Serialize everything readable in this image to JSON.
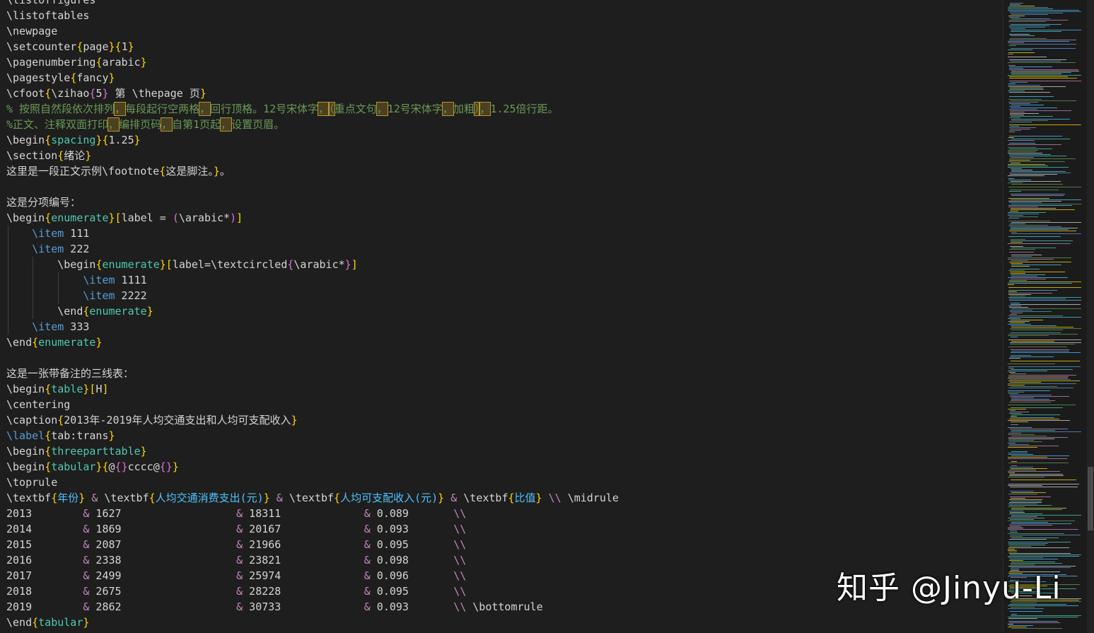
{
  "editor": {
    "colors": {
      "background": "#1e1e1e",
      "text": "#d4d4d4",
      "keyword": "#569cd6",
      "environment": "#4ec9b0",
      "bracket": "#ffd700",
      "comment": "#6a9955",
      "ampersand": "#c586c0",
      "bold_text": "#4fc1ff"
    },
    "lines": [
      "\\listoffigures",
      "\\listoftables",
      "\\newpage",
      "\\setcounter{page}{1}",
      "\\pagenumbering{arabic}",
      "\\pagestyle{fancy}",
      "\\cfoot{\\zihao{5} 第 \\thepage 页}",
      "% 按照自然段依次排列，每段起行空两格，回行顶格。12号宋体字，（重点文句，12号宋体字，加粗），1.25倍行距。",
      "%正文、注释双面打印，编排页码，自第1页起，设置页眉。",
      "\\begin{spacing}{1.25}",
      "\\section{绪论}",
      "这里是一段正文示例\\footnote{这是脚注。}。",
      "",
      "这是分项编号：",
      "\\begin{enumerate}[label = (\\arabic*)]",
      "    \\item 111",
      "    \\item 222",
      "        \\begin{enumerate}[label=\\textcircled{\\arabic*}]",
      "            \\item 1111",
      "            \\item 2222",
      "        \\end{enumerate}",
      "    \\item 333",
      "\\end{enumerate}",
      "",
      "这是一张带备注的三线表：",
      "\\begin{table}[H]",
      "\\centering",
      "\\caption{2013年-2019年人均交通支出和人均可支配收入}",
      "\\label{tab:trans}",
      "\\begin{threeparttable}",
      "\\begin{tabular}{@{}cccc@{}}",
      "\\toprule",
      "\\textbf{年份} & \\textbf{人均交通消费支出(元)} & \\textbf{人均可支配收入(元)} & \\textbf{比值} \\\\ \\midrule",
      "2013        & 1627                  & 18311             & 0.089       \\\\",
      "2014        & 1869                  & 20167             & 0.093       \\\\",
      "2015        & 2087                  & 21966             & 0.095       \\\\",
      "2016        & 2338                  & 23821             & 0.098       \\\\",
      "2017        & 2499                  & 25974             & 0.096       \\\\",
      "2018        & 2675                  & 28228             & 0.095       \\\\",
      "2019        & 2862                  & 30733             & 0.093       \\\\ \\bottomrule",
      "\\end{tabular}"
    ]
  },
  "watermark": {
    "text": "知乎 @Jinyu-Li"
  }
}
